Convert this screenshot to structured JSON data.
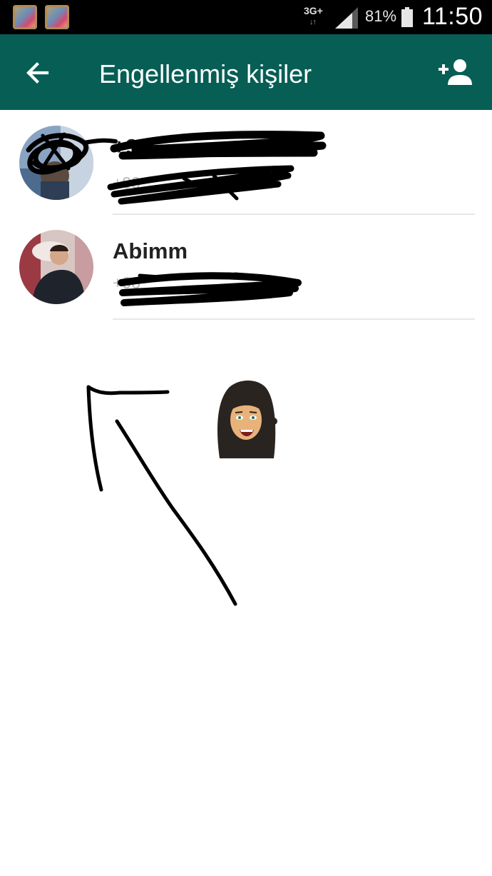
{
  "status_bar": {
    "network_type": "3G+",
    "network_arrows": "↓↑",
    "battery_percent": "81%",
    "time": "11:50",
    "icons": [
      "notification-app-icon",
      "notification-app-icon",
      "signal-icon",
      "battery-icon"
    ]
  },
  "app_bar": {
    "title": "Engellenmiş kişiler",
    "back_icon": "arrow-left-icon",
    "action_icon": "add-person-icon",
    "background": "#075e54"
  },
  "blocked_contacts": [
    {
      "name": "+90 ",
      "phone": "+90 ",
      "redacted": true
    },
    {
      "name": "Abimm",
      "phone": "+90 ",
      "redacted": true
    }
  ]
}
